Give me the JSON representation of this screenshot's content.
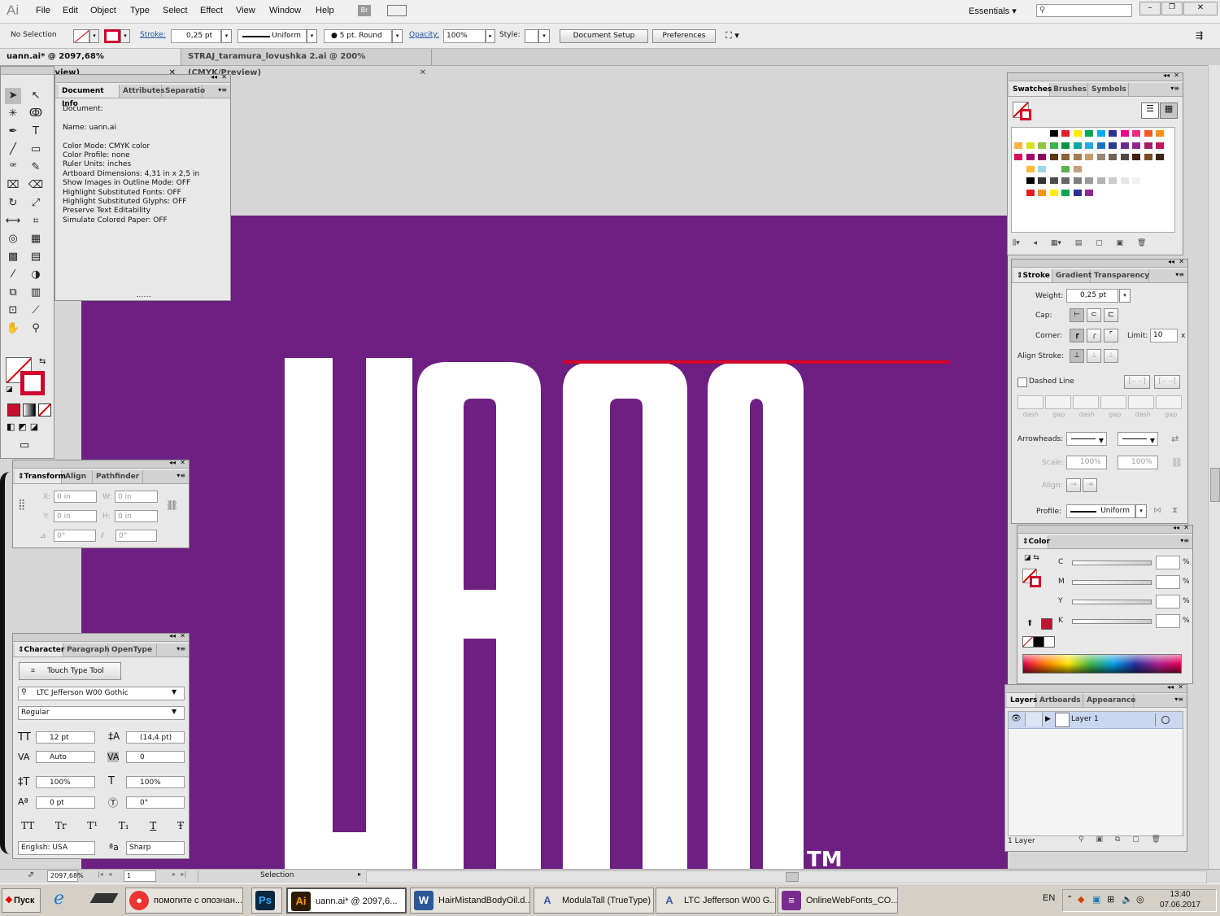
{
  "app": {
    "logo": "Ai",
    "workspace": "Essentials"
  },
  "menu": [
    "File",
    "Edit",
    "Object",
    "Type",
    "Select",
    "Effect",
    "View",
    "Window",
    "Help"
  ],
  "bridge_label": "Br",
  "control_bar": {
    "selection": "No Selection",
    "stroke_label": "Stroke:",
    "stroke_weight": "0,25 pt",
    "profile": "Uniform",
    "brush": "5 pt. Round",
    "opacity_label": "Opacity:",
    "opacity": "100%",
    "style_label": "Style:",
    "document_setup": "Document Setup",
    "preferences": "Preferences"
  },
  "doc_tabs": [
    "uann.ai* @ 2097,68% (CMYK/Preview)",
    "STRAJ_taramura_lovushka 2.ai @ 200% (CMYK/Preview)"
  ],
  "doc_info": {
    "tabs": [
      "Document Info",
      "Attributes",
      "Separatio"
    ],
    "lines": [
      "Document:",
      "",
      "Name: uann.ai",
      "",
      "Color Mode: CMYK color",
      "Color Profile: none",
      "Ruler Units: inches",
      "Artboard Dimensions: 4,31 in x 2,5 in",
      "Show Images in Outline Mode: OFF",
      "Highlight Substituted Fonts: OFF",
      "Highlight Substituted Glyphs: OFF",
      "Preserve Text Editability",
      "Simulate Colored Paper: OFF"
    ]
  },
  "transform": {
    "tabs": [
      "Transform",
      "Align",
      "Pathfinder"
    ],
    "x_label": "X:",
    "x": "0 in",
    "w_label": "W:",
    "w": "0 in",
    "y_label": "Y:",
    "y": "0 in",
    "h_label": "H:",
    "h": "0 in",
    "rotate": "0°",
    "shear": "0°"
  },
  "character": {
    "tabs": [
      "Character",
      "Paragraph",
      "OpenType"
    ],
    "touch_type": "Touch Type Tool",
    "font": "LTC Jefferson W00 Gothic",
    "style": "Regular",
    "size": "12 pt",
    "leading": "(14,4 pt)",
    "kerning": "Auto",
    "tracking": "0",
    "vscale": "100%",
    "hscale": "100%",
    "baseline": "0 pt",
    "rotation": "0°",
    "language": "English: USA",
    "antialias": "Sharp",
    "caps": [
      "TT",
      "Tr",
      "T¹",
      "T₁",
      "T",
      "Ŧ"
    ]
  },
  "swatches": {
    "tabs": [
      "Swatches",
      "Brushes",
      "Symbols"
    ]
  },
  "stroke_panel": {
    "tabs": [
      "Stroke",
      "Gradient",
      "Transparency"
    ],
    "weight_label": "Weight:",
    "weight": "0,25 pt",
    "cap_label": "Cap:",
    "corner_label": "Corner:",
    "limit_label": "Limit:",
    "limit": "10",
    "limit_unit": "x",
    "align_label": "Align Stroke:",
    "dashed": "Dashed Line",
    "dash_labels": [
      "dash",
      "gap",
      "dash",
      "gap",
      "dash",
      "gap"
    ],
    "arrowheads_label": "Arrowheads:",
    "scale_label": "Scale:",
    "scale1": "100%",
    "scale2": "100%",
    "align2_label": "Align:",
    "profile_label": "Profile:",
    "profile": "Uniform"
  },
  "color_panel": {
    "tabs": [
      "Color"
    ],
    "channels": [
      "C",
      "M",
      "Y",
      "K"
    ],
    "pct": "%"
  },
  "layers": {
    "tabs": [
      "Layers",
      "Artboards",
      "Appearance"
    ],
    "layer": "Layer 1",
    "count": "1 Layer"
  },
  "status": {
    "zoom": "2097,68%",
    "artboard": "1",
    "tool": "Selection"
  },
  "artwork": {
    "text": "uann",
    "tm": "TM",
    "bg": "#6d1f82",
    "line_color": "#d6002a"
  },
  "taskbar": {
    "start": "Пуск",
    "items": [
      "помогите с опознан...",
      "",
      "uann.ai* @ 2097,6...",
      "HairMistandBodyOil.d...",
      "ModulaTall (TrueType)",
      "LTC Jefferson W00 G...",
      "OnlineWebFonts_CO..."
    ],
    "lang": "EN",
    "time": "13:40",
    "date": "07.06.2017"
  }
}
